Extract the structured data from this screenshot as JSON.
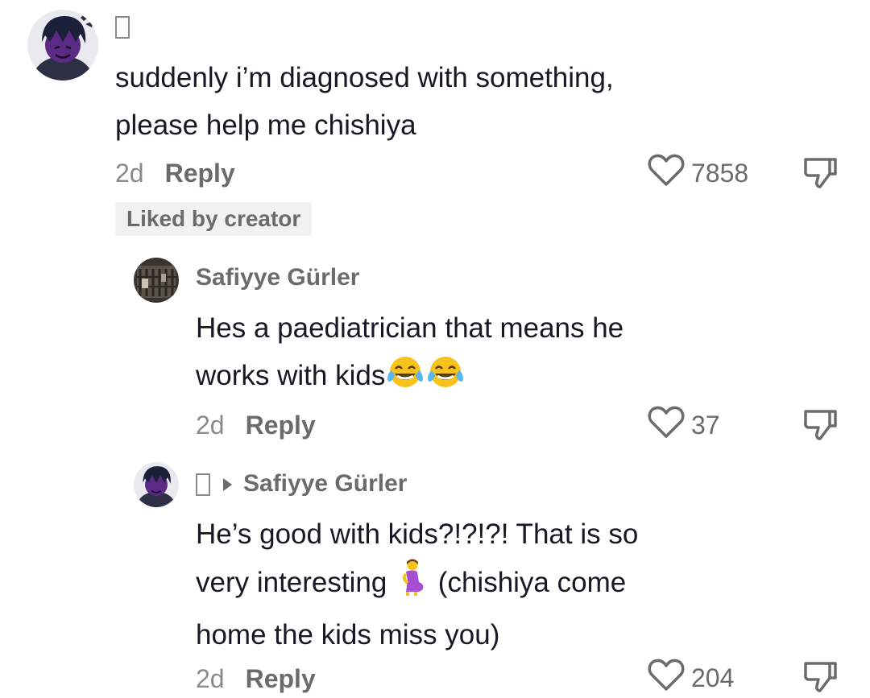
{
  "comments": [
    {
      "username": "",
      "text_lines": [
        "suddenly i’m diagnosed with something,",
        "please help me chishiya"
      ],
      "age": "2d",
      "reply_label": "Reply",
      "like_count": "7858",
      "badge": "Liked by creator"
    },
    {
      "username": "Safiyye Gürler",
      "text_lines": [
        "Hes a paediatrician that means he",
        "works with kids"
      ],
      "text_emoji": [
        "face-with-tears-of-joy-emoji",
        "face-with-tears-of-joy-emoji"
      ],
      "age": "2d",
      "reply_label": "Reply",
      "like_count": "37"
    },
    {
      "username": "",
      "reply_to": "Safiyye Gürler",
      "text_lines": [
        "He’s good with kids?!?!?! That is so",
        "very interesting",
        "(chishiya come",
        "home the kids miss you)"
      ],
      "text_emoji": [
        "pregnant-woman-emoji"
      ],
      "age": "2d",
      "reply_label": "Reply",
      "like_count": "204"
    }
  ],
  "icons": {
    "like": "heart-outline-icon",
    "dislike": "thumbs-down-icon"
  },
  "colors": {
    "text": "#161823",
    "muted": "#8a8a8a",
    "badge_bg": "#f1f1f2",
    "emoji_yellow": "#f7c21c",
    "emoji_purple": "#a64fd0"
  }
}
